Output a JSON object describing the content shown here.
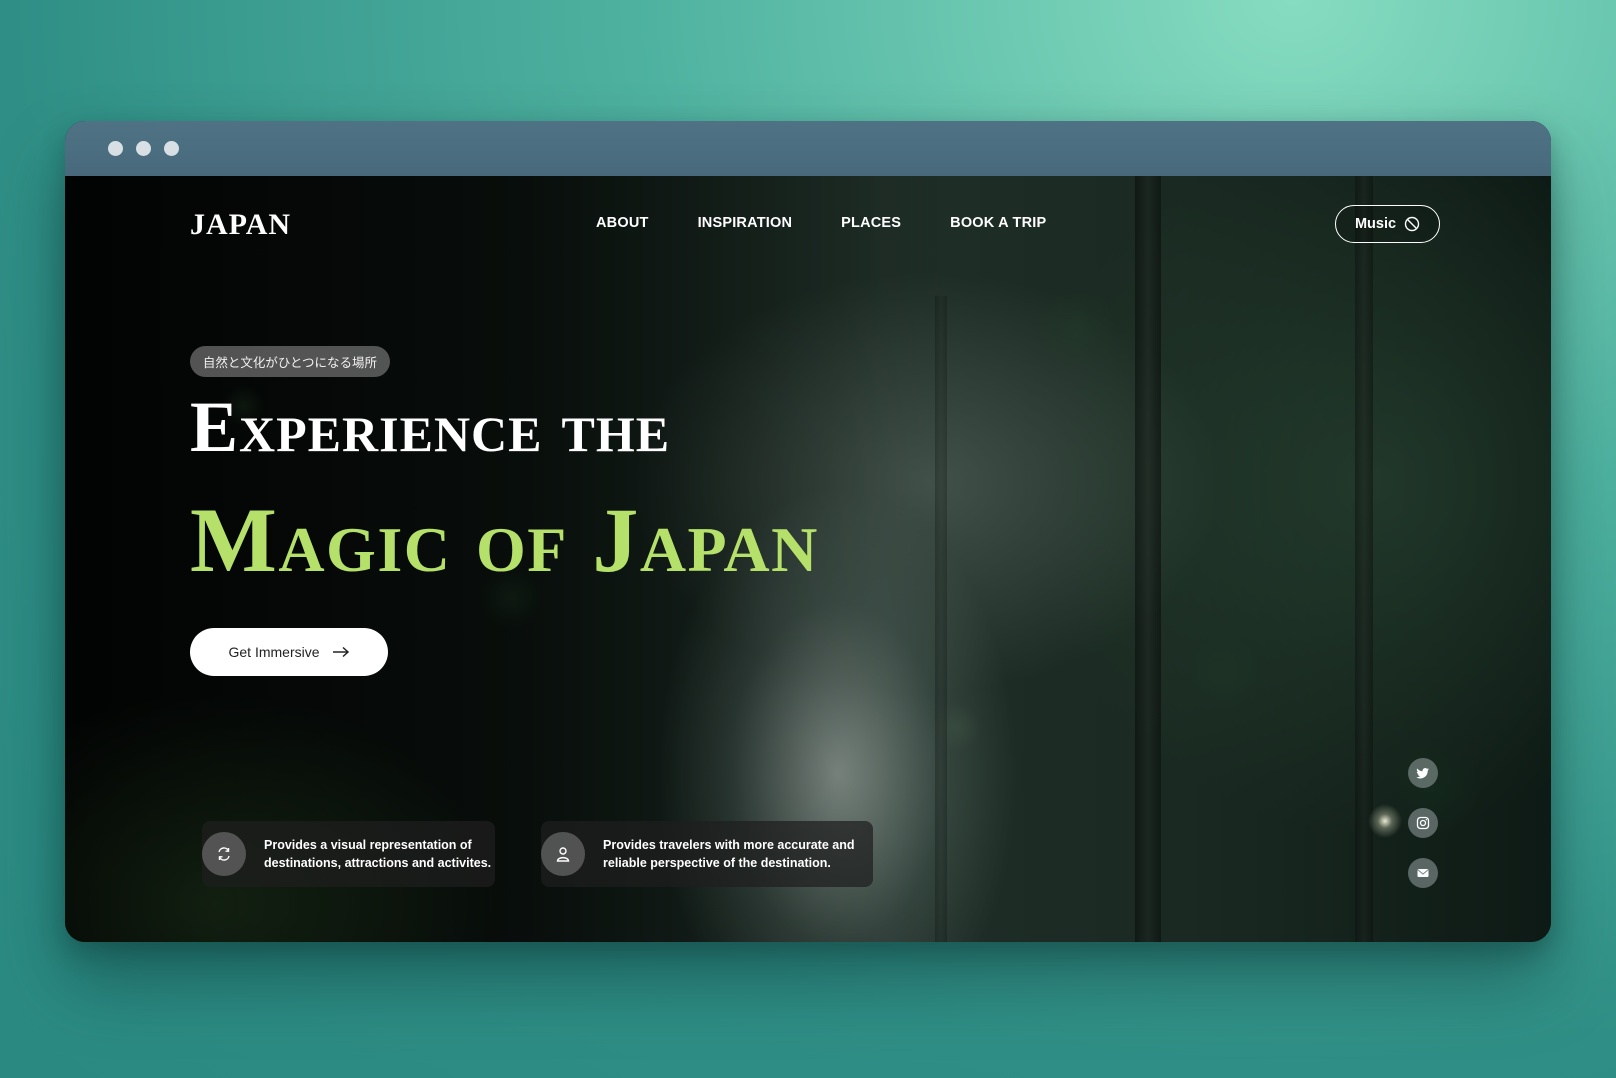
{
  "window": {
    "dots": [
      "",
      "",
      ""
    ]
  },
  "site": {
    "logo": "JAPAN",
    "nav": [
      "ABOUT",
      "INSPIRATION",
      "PLACES",
      "BOOK A TRIP"
    ],
    "music_label": "Music",
    "tagline": "自然と文化がひとつになる場所",
    "headline_line1": "Experience the",
    "headline_line2": "Magic of Japan",
    "cta_label": "Get Immersive",
    "features": [
      {
        "icon": "refresh-icon",
        "text_line1": "Provides a visual representation of",
        "text_line2": "destinations, attractions and activites."
      },
      {
        "icon": "user-icon",
        "text_line1": "Provides travelers with more accurate and",
        "text_line2": "reliable perspective of the destination."
      }
    ],
    "social": [
      "twitter-icon",
      "instagram-icon",
      "mail-icon"
    ],
    "colors": {
      "accent": "#b5e06a",
      "background": "#2f8f86"
    }
  }
}
